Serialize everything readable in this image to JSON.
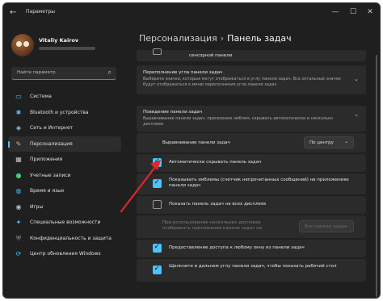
{
  "window": {
    "app_title": "Параметры",
    "back_glyph": "←",
    "min_glyph": "—",
    "max_glyph": "☐",
    "close_glyph": "✕"
  },
  "user": {
    "name": "Vitaliy Kairov"
  },
  "search": {
    "placeholder": "Найти параметр",
    "icon": "search-icon",
    "glyph": "⌕"
  },
  "sidebar": {
    "items": [
      {
        "label": "Система",
        "icon": "monitor-icon",
        "glyph": "▭",
        "color": "#4cc2ff"
      },
      {
        "label": "Bluetooth и устройства",
        "icon": "bluetooth-icon",
        "glyph": "✱",
        "color": "#4cc2ff"
      },
      {
        "label": "Сеть и Интернет",
        "icon": "wifi-icon",
        "glyph": "◈",
        "color": "#9ecbea"
      },
      {
        "label": "Персонализация",
        "icon": "brush-icon",
        "glyph": "✎",
        "color": "#f2b366"
      },
      {
        "label": "Приложения",
        "icon": "apps-icon",
        "glyph": "▦",
        "color": "#c8c8c8"
      },
      {
        "label": "Учетные записи",
        "icon": "person-icon",
        "glyph": "●",
        "color": "#3ad07a"
      },
      {
        "label": "Время и язык",
        "icon": "globe-icon",
        "glyph": "◍",
        "color": "#4cc2ff"
      },
      {
        "label": "Игры",
        "icon": "gamepad-icon",
        "glyph": "◉",
        "color": "#bdbdbd"
      },
      {
        "label": "Специальные возможности",
        "icon": "accessibility-icon",
        "glyph": "✦",
        "color": "#4cc2ff"
      },
      {
        "label": "Конфиденциальность и защита",
        "icon": "shield-icon",
        "glyph": "⛨",
        "color": "#9a9a9a"
      },
      {
        "label": "Центр обновления Windows",
        "icon": "refresh-icon",
        "glyph": "⟳",
        "color": "#4cc2ff"
      }
    ],
    "active_index": 3
  },
  "main": {
    "breadcrumb": {
      "parent": "Персонализация",
      "separator": "›",
      "current": "Панель задач"
    },
    "partial_row": {
      "label": "сенсорной панели"
    },
    "overflow_panel": {
      "title": "Переполнение угла панели задач",
      "description": "Выберите значки, которые могут отображаться в углу панели задач. Все остальные значки будут отображаться в меню переполнения угла панели задач",
      "chevron": "⌄"
    },
    "behavior_panel": {
      "title": "Поведение панели задач",
      "description": "Выравнивание панели задач, присвоение эмблем, скрывать автоматически и несколько дисплеев",
      "chevron": "⌃"
    },
    "alignment": {
      "label": "Выравнивание панели задач",
      "value": "По центру",
      "dd": "⌄"
    },
    "options": [
      {
        "label": "Автоматически скрывать панель задач",
        "checked": true
      },
      {
        "label": "Показывать эмблемы (счетчик непрочитанных сообщений) на приложениях панели задач",
        "checked": true
      },
      {
        "label": "Показать панель задач на всех дисплеях",
        "checked": false
      }
    ],
    "multi_display": {
      "label": "При использовании нескольких дисплеев отображать приложения панели задач на",
      "value": "Все панели задач",
      "dd": "⌄",
      "disabled": true
    },
    "options2": [
      {
        "label": "Предоставление доступа к любому окну из панели задач",
        "checked": true
      },
      {
        "label": "Щелкните в дальнем углу панели задач, чтобы показать рабочий стол",
        "checked": true
      }
    ]
  },
  "annotation": {
    "arrow_color": "#e0262b"
  }
}
